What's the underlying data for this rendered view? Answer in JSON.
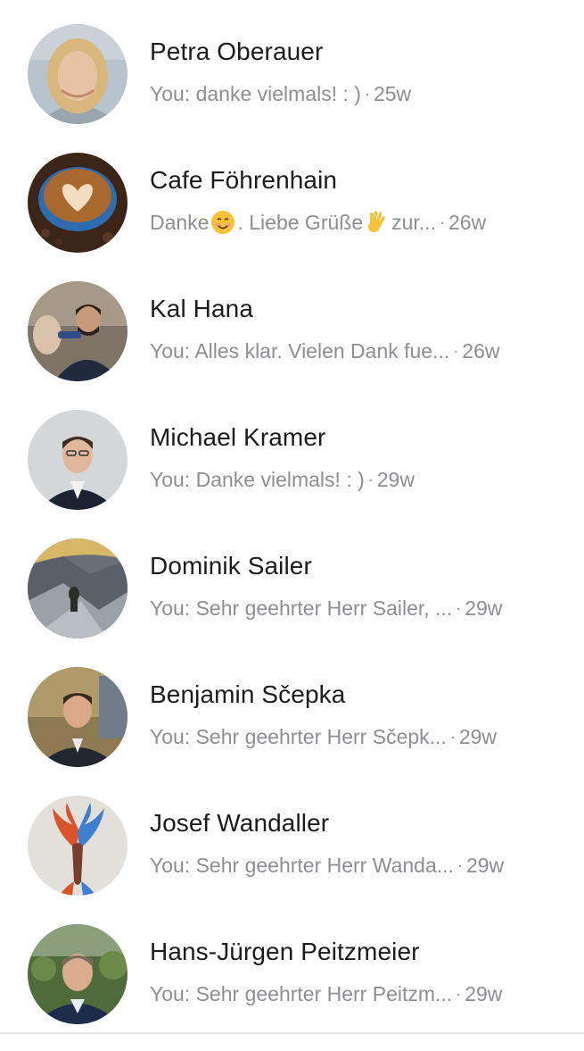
{
  "conversations": [
    {
      "name": "Petra Oberauer",
      "preview_before": "You: danke vielmals! : )",
      "time": "25w",
      "avatar_colors": {
        "bg": "#b8c4cc",
        "skin": "#e8c2a5",
        "hair": "#d9b77c",
        "clothes": "#9aa6ad"
      }
    },
    {
      "name": "Cafe Föhrenhain",
      "preview_before": "Danke",
      "preview_middle": ". Liebe Grüße",
      "preview_after": " zur...",
      "preview_emoji_1": "smiling-face-emoji",
      "preview_emoji_2": "vulcan-salute-emoji",
      "time": "26w",
      "avatar_colors": {
        "bg": "#3b2418",
        "cup": "#2e6cb0",
        "coffee": "#a8682e",
        "foam": "#f2ddc0"
      }
    },
    {
      "name": "Kal Hana",
      "preview_before": "You: Alles klar. Vielen Dank fue...",
      "time": "26w",
      "avatar_colors": {
        "bg": "#7d7466",
        "skin": "#c69a7a",
        "hair": "#2b2119",
        "clothes": "#1f2a3c"
      }
    },
    {
      "name": "Michael Kramer",
      "preview_before": "You: Danke vielmals! : )",
      "time": "29w",
      "avatar_colors": {
        "bg": "#d4d6d8",
        "skin": "#e0b79a",
        "hair": "#3a2c23",
        "clothes": "#1b2230"
      }
    },
    {
      "name": "Dominik Sailer",
      "preview_before": "You: Sehr geehrter Herr Sailer, ...",
      "time": "29w",
      "avatar_colors": {
        "bg": "#6a6f76",
        "rock": "#9aa1a8",
        "sky": "#d7b866",
        "figure": "#2a2f25"
      }
    },
    {
      "name": "Benjamin Sčepka",
      "preview_before": "You: Sehr geehrter Herr Sčepk...",
      "time": "29w",
      "avatar_colors": {
        "bg": "#8e7a52",
        "skin": "#d9a98a",
        "hair": "#3a2a1e",
        "clothes": "#22272f"
      }
    },
    {
      "name": "Josef Wandaller",
      "preview_before": "You: Sehr geehrter Herr Wanda...",
      "time": "29w",
      "avatar_colors": {
        "bg": "#e3e0dc",
        "wing_left": "#d9542a",
        "wing_right": "#3f7fd0",
        "body": "#7a3e2e"
      }
    },
    {
      "name": "Hans-Jürgen Peitzmeier",
      "preview_before": "You: Sehr geehrter Herr Peitzm...",
      "time": "29w",
      "avatar_colors": {
        "bg": "#4f6b3a",
        "skin": "#d9ad8e",
        "hair": "#7a6a5a",
        "clothes": "#1e2c4a"
      }
    }
  ],
  "separator": "·"
}
